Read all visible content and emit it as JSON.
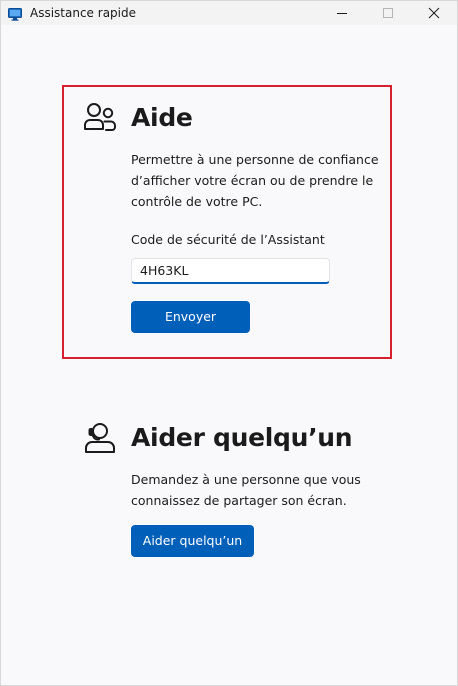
{
  "window": {
    "title": "Assistance rapide",
    "icon": "quick-assist-monitor-icon",
    "controls": [
      "minimize-icon",
      "maximize-icon",
      "close-icon"
    ]
  },
  "get_help": {
    "icon": "people-icon",
    "title": "Aide",
    "description": "Permettre à une personne de confiance d’afficher votre écran ou de prendre le contrôle de votre PC.",
    "code_label": "Code de sécurité de l’Assistant",
    "code_value": "4H63KL",
    "submit_label": "Envoyer"
  },
  "give_help": {
    "icon": "person-headset-icon",
    "title": "Aider quelqu’un",
    "description": "Demandez à une personne que vous connaissez de partager son écran.",
    "button_label": "Aider quelqu’un"
  },
  "colors": {
    "accent": "#005fb8",
    "highlight_border": "#d6202b",
    "background": "#f9f9fb"
  }
}
